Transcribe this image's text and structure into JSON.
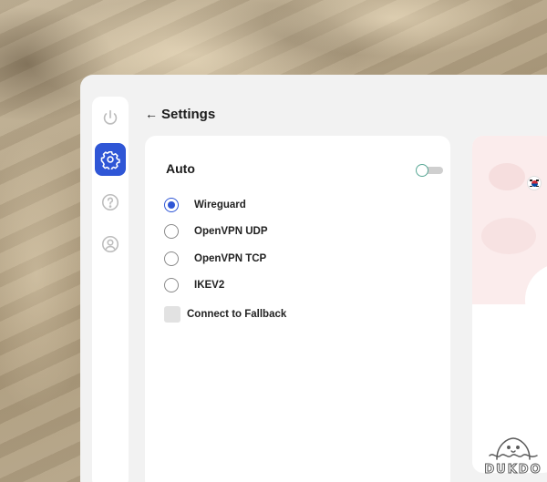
{
  "header": {
    "back_arrow": "←",
    "title": "Settings"
  },
  "sidebar": {
    "items": [
      {
        "name": "power",
        "icon": "power-icon",
        "active": false
      },
      {
        "name": "settings",
        "icon": "gear-icon",
        "active": true
      },
      {
        "name": "help",
        "icon": "help-icon",
        "active": false
      },
      {
        "name": "account",
        "icon": "user-icon",
        "active": false
      }
    ]
  },
  "protocol": {
    "auto_label": "Auto",
    "auto_enabled": false,
    "options": [
      {
        "label": "Wireguard",
        "selected": true
      },
      {
        "label": "OpenVPN UDP",
        "selected": false
      },
      {
        "label": "OpenVPN TCP",
        "selected": false
      },
      {
        "label": "IKEV2",
        "selected": false
      }
    ],
    "fallback_label": "Connect to Fallback",
    "fallback_checked": false
  },
  "map": {
    "flag_icon": "south-korea-flag-icon"
  },
  "watermark": {
    "text": "DUKDO"
  },
  "colors": {
    "accent": "#2f56d6",
    "toggle_knob_border": "#5aa896",
    "map_bg": "#fbecec"
  }
}
